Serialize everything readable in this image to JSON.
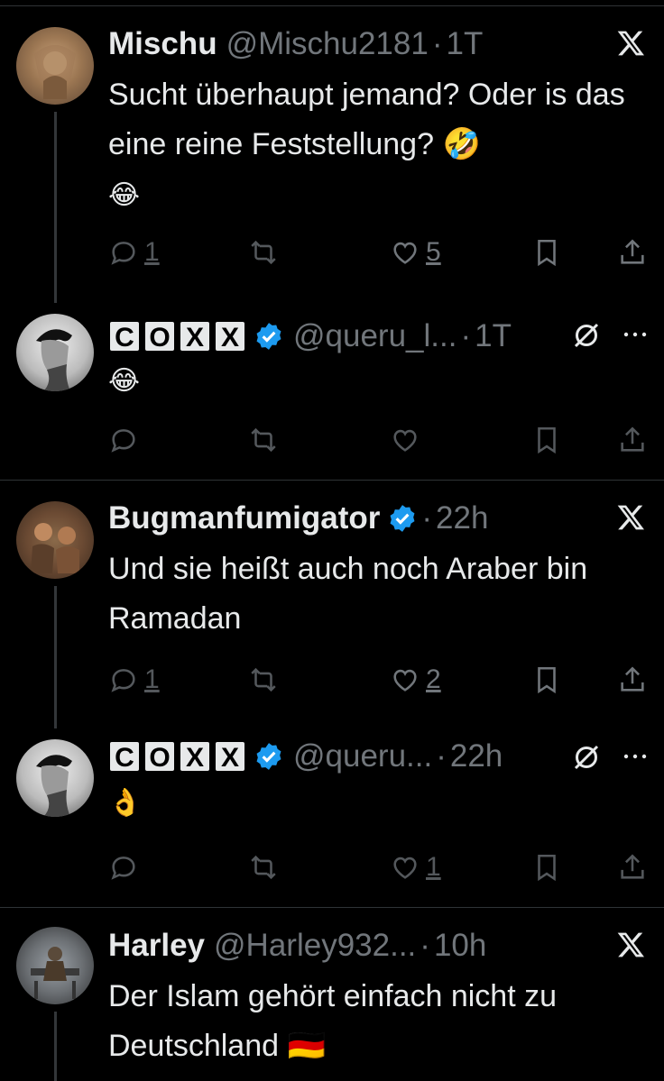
{
  "tweets": [
    {
      "name": "Mischu",
      "handle": "@Mischu2181",
      "time": "1T",
      "text": "Sucht überhaupt jemand? Oder is das eine reine Feststellung? 🤣",
      "text2": "😂",
      "reply_count": "1",
      "like_count": "5"
    },
    {
      "name_letters": [
        "C",
        "O",
        "X",
        "X"
      ],
      "handle": "@queru_l...",
      "time": "1T",
      "text": "😂"
    },
    {
      "name": "Bugmanfumigator",
      "time": "22h",
      "text": "Und sie heißt auch noch Araber bin Ramadan",
      "reply_count": "1",
      "like_count": "2"
    },
    {
      "name_letters": [
        "C",
        "O",
        "X",
        "X"
      ],
      "handle": "@queru...",
      "time": "22h",
      "text": "👌",
      "like_count": "1"
    },
    {
      "name": "Harley",
      "handle": "@Harley932...",
      "time": "10h",
      "text": "Der Islam gehört einfach nicht zu Deutschland 🇩🇪"
    }
  ],
  "separator": "·",
  "icons": [
    "reply-icon",
    "retweet-icon",
    "like-icon",
    "bookmark-icon",
    "share-icon",
    "x-logo-icon",
    "verified-badge-icon",
    "mute-icon",
    "more-icon"
  ],
  "colors": {
    "background": "#000000",
    "text": "#e7e9ea",
    "muted": "#71767b",
    "verified": "#1d9bf0",
    "divider": "#2f3336"
  }
}
